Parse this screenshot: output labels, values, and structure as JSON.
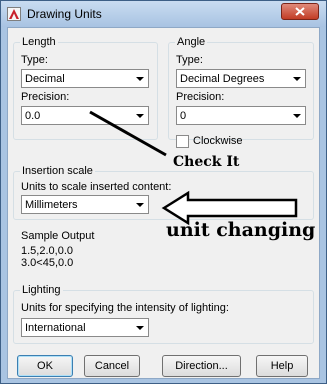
{
  "window": {
    "title": "Drawing Units"
  },
  "length": {
    "group_label": "Length",
    "type_label": "Type:",
    "type_value": "Decimal",
    "precision_label": "Precision:",
    "precision_value": "0.0"
  },
  "angle": {
    "group_label": "Angle",
    "type_label": "Type:",
    "type_value": "Decimal Degrees",
    "precision_label": "Precision:",
    "precision_value": "0",
    "clockwise_label": "Clockwise",
    "clockwise_checked": false
  },
  "insertion": {
    "group_label": "Insertion scale",
    "units_label": "Units to scale inserted content:",
    "units_value": "Millimeters"
  },
  "sample": {
    "label": "Sample Output",
    "line1": "1.5,2.0,0.0",
    "line2": "3.0<45,0.0"
  },
  "lighting": {
    "group_label": "Lighting",
    "units_label": "Units for specifying the intensity of lighting:",
    "units_value": "International"
  },
  "buttons": {
    "ok": "OK",
    "cancel": "Cancel",
    "direction": "Direction...",
    "help": "Help"
  },
  "annotations": {
    "check_it": "Check It",
    "unit_changing": "unit changing"
  },
  "colors": {
    "frame": "#a9c4e2",
    "close_button": "#c23c25",
    "dialog_bg": "#f0f0f0"
  }
}
